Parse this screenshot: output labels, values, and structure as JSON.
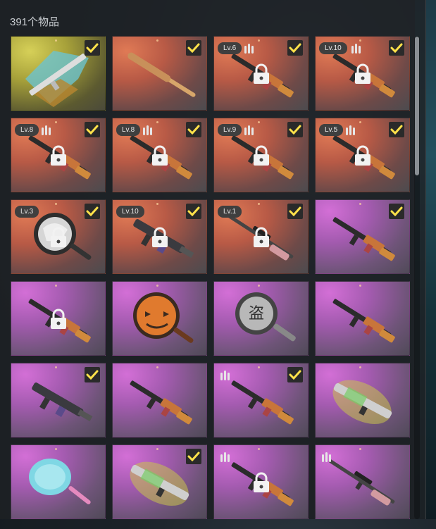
{
  "inventory": {
    "count_label": "391个物品"
  },
  "colors": {
    "legendary": "#a7a13a",
    "epic": "#b85a46",
    "rare": "#a45bb0",
    "check": "#ffe24a"
  },
  "items": [
    {
      "rarity": "gold",
      "checked": true,
      "level": "",
      "ammo": false,
      "locked": false,
      "icon": "camo-rifle-icon"
    },
    {
      "rarity": "red",
      "checked": true,
      "level": "",
      "ammo": false,
      "locked": false,
      "icon": "baseball-bat-icon"
    },
    {
      "rarity": "red",
      "checked": true,
      "level": "Lv.6",
      "ammo": true,
      "locked": true,
      "icon": "rifle-icon"
    },
    {
      "rarity": "red",
      "checked": true,
      "level": "Lv.10",
      "ammo": true,
      "locked": true,
      "icon": "rifle-icon"
    },
    {
      "rarity": "red",
      "checked": true,
      "level": "Lv.8",
      "ammo": true,
      "locked": true,
      "icon": "rifle-icon"
    },
    {
      "rarity": "red",
      "checked": true,
      "level": "Lv.8",
      "ammo": true,
      "locked": true,
      "icon": "rifle-icon"
    },
    {
      "rarity": "red",
      "checked": true,
      "level": "Lv.9",
      "ammo": true,
      "locked": true,
      "icon": "rifle-icon"
    },
    {
      "rarity": "red",
      "checked": true,
      "level": "Lv.5",
      "ammo": true,
      "locked": true,
      "icon": "rifle-icon"
    },
    {
      "rarity": "red",
      "checked": true,
      "level": "Lv.3",
      "ammo": false,
      "locked": true,
      "icon": "pan-icon"
    },
    {
      "rarity": "red",
      "checked": true,
      "level": "Lv.10",
      "ammo": false,
      "locked": true,
      "icon": "smg-icon"
    },
    {
      "rarity": "red",
      "checked": true,
      "level": "Lv.1",
      "ammo": false,
      "locked": true,
      "icon": "sniper-icon"
    },
    {
      "rarity": "purple",
      "checked": true,
      "level": "",
      "ammo": false,
      "locked": false,
      "icon": "rifle-icon"
    },
    {
      "rarity": "purple",
      "checked": false,
      "level": "",
      "ammo": false,
      "locked": true,
      "icon": "rifle-icon"
    },
    {
      "rarity": "purple",
      "checked": false,
      "level": "",
      "ammo": false,
      "locked": false,
      "icon": "pumpkin-pan-icon"
    },
    {
      "rarity": "purple",
      "checked": false,
      "level": "",
      "ammo": false,
      "locked": false,
      "icon": "emblem-pan-icon"
    },
    {
      "rarity": "purple",
      "checked": false,
      "level": "",
      "ammo": false,
      "locked": false,
      "icon": "rifle-icon"
    },
    {
      "rarity": "purple",
      "checked": true,
      "level": "",
      "ammo": false,
      "locked": false,
      "icon": "smg-icon"
    },
    {
      "rarity": "purple",
      "checked": false,
      "level": "",
      "ammo": false,
      "locked": false,
      "icon": "rifle-icon"
    },
    {
      "rarity": "purple",
      "checked": true,
      "level": "",
      "ammo": true,
      "locked": false,
      "icon": "rifle-icon"
    },
    {
      "rarity": "purple",
      "checked": false,
      "level": "",
      "ammo": false,
      "locked": false,
      "icon": "shotgun-icon"
    },
    {
      "rarity": "purple",
      "checked": false,
      "level": "",
      "ammo": false,
      "locked": false,
      "icon": "candy-pan-icon"
    },
    {
      "rarity": "purple",
      "checked": true,
      "level": "",
      "ammo": false,
      "locked": false,
      "icon": "shotgun-icon"
    },
    {
      "rarity": "purple",
      "checked": false,
      "level": "",
      "ammo": true,
      "locked": true,
      "icon": "rifle-icon"
    },
    {
      "rarity": "purple",
      "checked": false,
      "level": "",
      "ammo": true,
      "locked": false,
      "icon": "sniper-icon"
    }
  ]
}
